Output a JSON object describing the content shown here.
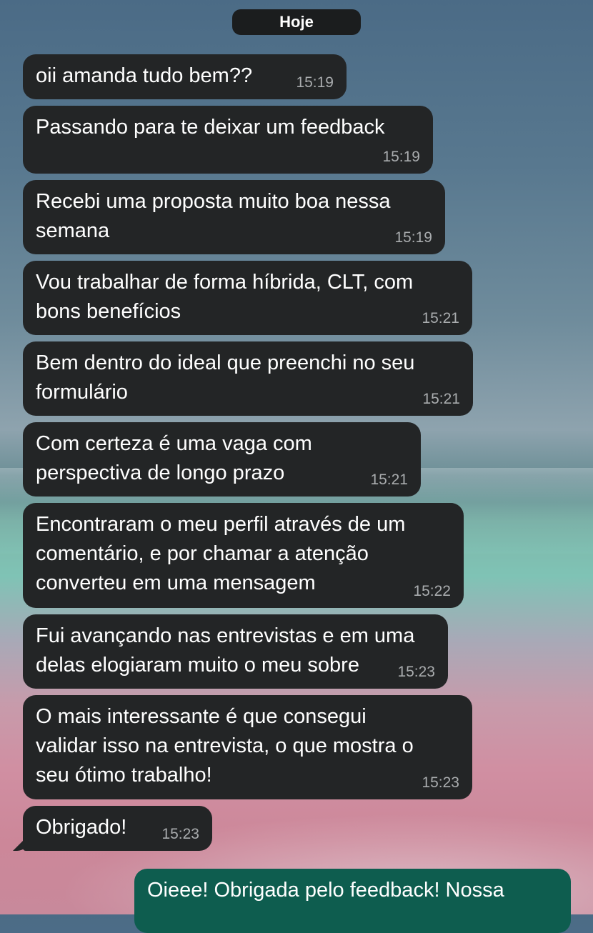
{
  "date_separator": "Hoje",
  "messages": [
    {
      "text": "oii amanda tudo bem??",
      "time": "15:19"
    },
    {
      "text": "Passando para te deixar um feedback",
      "time": "15:19"
    },
    {
      "text": "Recebi uma proposta muito boa nessa\nsemana",
      "time": "15:19"
    },
    {
      "text": "Vou trabalhar de forma híbrida, CLT, com\nbons benefícios",
      "time": "15:21"
    },
    {
      "text": "Bem dentro do ideal que preenchi no seu\nformulário",
      "time": "15:21"
    },
    {
      "text": "Com certeza é uma vaga com\nperspectiva de longo prazo",
      "time": "15:21"
    },
    {
      "text": "Encontraram o meu perfil através de um\ncomentário, e por chamar a atenção\nconverteu em uma mensagem",
      "time": "15:22"
    },
    {
      "text": "Fui avançando nas entrevistas e em uma\ndelas elogiaram muito o meu sobre",
      "time": "15:23"
    },
    {
      "text": "O mais interessante é que consegui\nvalidar isso na entrevista, o que mostra o\nseu ótimo trabalho!",
      "time": "15:23"
    },
    {
      "text": "Obrigado!",
      "time": "15:23"
    }
  ],
  "outgoing": {
    "text": "Oieee! Obrigada pelo feedback! Nossa"
  },
  "colors": {
    "incoming_bubble": "#232526",
    "outgoing_bubble": "#0e5d4f",
    "timestamp": "#a9acae"
  }
}
